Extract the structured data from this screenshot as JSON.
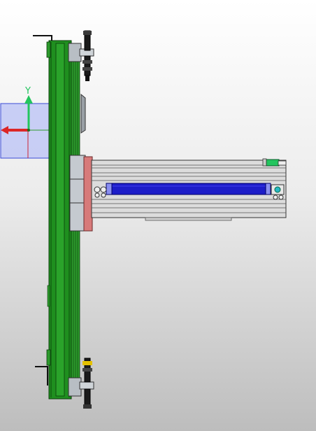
{
  "viewport": {
    "background_top": "#ffffff",
    "background_bottom": "#bdbdbd"
  },
  "triad": {
    "y_label": "Y",
    "y_color": "#22c55e",
    "x_color": "#dc2626",
    "plane_color": "#b9c2f5"
  },
  "model": {
    "rail_color": "#1f8f1f",
    "plate_color": "#d77a7a",
    "cylinder_color": "#1d1dc8",
    "profile_color": "#dcdcdc",
    "indicator_color": "#22c55e"
  }
}
